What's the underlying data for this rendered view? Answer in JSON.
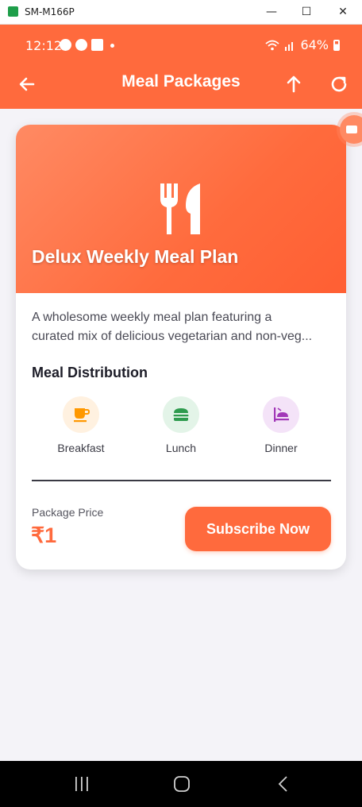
{
  "window": {
    "title": "SM-M166P",
    "minimize": "—",
    "maximize": "☐",
    "close": "✕"
  },
  "status_bar": {
    "time": "12:12",
    "battery": "64%"
  },
  "app_bar": {
    "title": "Meal Packages",
    "icons": [
      "back-arrow-icon",
      "up-arrow-icon",
      "refresh-icon"
    ]
  },
  "package": {
    "name": "Delux Weekly Meal Plan",
    "description_line1": "A wholesome weekly meal plan featuring a",
    "description_line2": "curated mix of delicious vegetarian and non-veg...",
    "distribution_title": "Meal Distribution",
    "meals": [
      {
        "label": "Breakfast",
        "icon": "coffee-cup-icon",
        "color": "#ff9800",
        "bg": "#fff1e0"
      },
      {
        "label": "Lunch",
        "icon": "burger-icon",
        "color": "#2e9b4e",
        "bg": "#e3f4e8"
      },
      {
        "label": "Dinner",
        "icon": "dinner-plate-icon",
        "color": "#a238b8",
        "bg": "#f4e3f8"
      }
    ],
    "price_label": "Package Price",
    "price": "₹1",
    "subscribe_label": "Subscribe Now"
  },
  "colors": {
    "accent": "#ff6a3d",
    "background": "#f4f3f8"
  }
}
